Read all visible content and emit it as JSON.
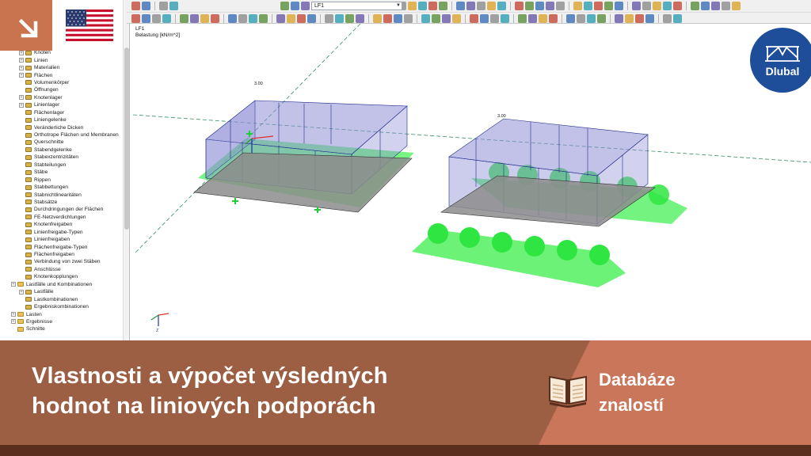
{
  "toolbar": {
    "load_case_select": "LF1"
  },
  "viewport": {
    "load_case": "LF1",
    "load_type": "Belastung [kN/m^2]",
    "load_value_left": "3.00",
    "load_value_right": "3.00",
    "axis_label": "Z"
  },
  "sidebar": {
    "items": [
      {
        "label": "Knoten",
        "level": 1,
        "expandable": true
      },
      {
        "label": "Linien",
        "level": 1,
        "expandable": true
      },
      {
        "label": "Materialien",
        "level": 1,
        "expandable": true
      },
      {
        "label": "Flächen",
        "level": 1,
        "expandable": true
      },
      {
        "label": "Volumenkörper",
        "level": 1,
        "expandable": false
      },
      {
        "label": "Öffnungen",
        "level": 1,
        "expandable": false
      },
      {
        "label": "Knotenlager",
        "level": 1,
        "expandable": true
      },
      {
        "label": "Linienlager",
        "level": 1,
        "expandable": true
      },
      {
        "label": "Flächenlager",
        "level": 1,
        "expandable": false
      },
      {
        "label": "Liniengelenke",
        "level": 1,
        "expandable": false
      },
      {
        "label": "Veränderliche Dicken",
        "level": 1,
        "expandable": false
      },
      {
        "label": "Orthotrope Flächen und Membranen",
        "level": 1,
        "expandable": false
      },
      {
        "label": "Querschnitte",
        "level": 1,
        "expandable": false
      },
      {
        "label": "Stabendgelenke",
        "level": 1,
        "expandable": false
      },
      {
        "label": "Stabexzentrizitäten",
        "level": 1,
        "expandable": false
      },
      {
        "label": "Stabteilungen",
        "level": 1,
        "expandable": false
      },
      {
        "label": "Stäbe",
        "level": 1,
        "expandable": false
      },
      {
        "label": "Rippen",
        "level": 1,
        "expandable": false
      },
      {
        "label": "Stabbettungen",
        "level": 1,
        "expandable": false
      },
      {
        "label": "Stabnichtlinearitäten",
        "level": 1,
        "expandable": false
      },
      {
        "label": "Stabsätze",
        "level": 1,
        "expandable": false
      },
      {
        "label": "Durchdringungen der Flächen",
        "level": 1,
        "expandable": false
      },
      {
        "label": "FE-Netzverdichtungen",
        "level": 1,
        "expandable": false
      },
      {
        "label": "Knotenfreigaben",
        "level": 1,
        "expandable": false
      },
      {
        "label": "Linienfreigabe-Typen",
        "level": 1,
        "expandable": false
      },
      {
        "label": "Linienfreigaben",
        "level": 1,
        "expandable": false
      },
      {
        "label": "Flächenfreigabe-Typen",
        "level": 1,
        "expandable": false
      },
      {
        "label": "Flächenfreigaben",
        "level": 1,
        "expandable": false
      },
      {
        "label": "Verbindung von zwei Stäben",
        "level": 1,
        "expandable": false
      },
      {
        "label": "Anschlüsse",
        "level": 1,
        "expandable": false
      },
      {
        "label": "Knotenkopplungen",
        "level": 1,
        "expandable": false
      },
      {
        "label": "Lastfälle und Kombinationen",
        "level": 0,
        "expandable": true
      },
      {
        "label": "Lastfälle",
        "level": 1,
        "expandable": true
      },
      {
        "label": "Lastkombinationen",
        "level": 1,
        "expandable": false
      },
      {
        "label": "Ergebniskombinationen",
        "level": 1,
        "expandable": false
      },
      {
        "label": "Lasten",
        "level": 0,
        "expandable": true
      },
      {
        "label": "Ergebnisse",
        "level": 0,
        "expandable": true
      },
      {
        "label": "Schnitte",
        "level": 0,
        "expandable": false
      }
    ]
  },
  "banner": {
    "title_line1": "Vlastnosti a výpočet výsledných",
    "title_line2": "hodnot na liniových podporách",
    "kb_line1": "Databáze",
    "kb_line2": "znalostí"
  },
  "logo": {
    "text": "Dlubal"
  },
  "colors": {
    "banner": "#9d5f43",
    "banner_light": "#c9765a",
    "logo_blue": "#1e4e9a",
    "support_green": "#33e24a",
    "load_blue": "#8f8fd6"
  },
  "icons": [
    "arrow-down-right-icon",
    "us-flag-icon",
    "book-icon",
    "dlubal-logo",
    "folder-icon",
    "coordinate-axes-icon"
  ]
}
